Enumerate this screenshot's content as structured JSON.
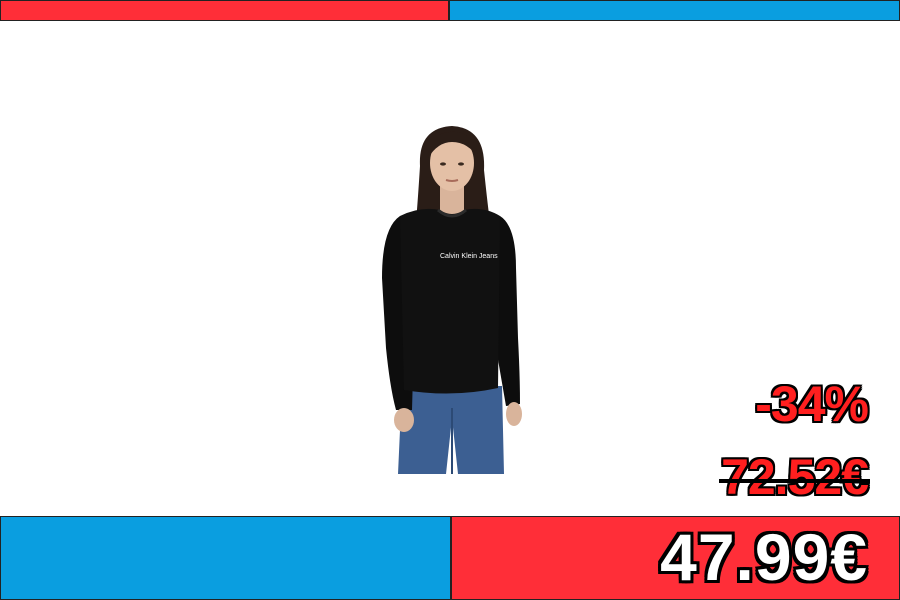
{
  "banner": {
    "top_left_color": "#ff2e38",
    "top_right_color": "#0a9ee0",
    "bottom_left_color": "#0a9ee0",
    "bottom_right_color": "#ff2e38"
  },
  "product": {
    "image_icon": "sweatshirt-model-photo",
    "print_text": "Calvin Klein Jeans"
  },
  "pricing": {
    "discount": "-34%",
    "old_price": "72.52€",
    "new_price": "47.99€"
  }
}
